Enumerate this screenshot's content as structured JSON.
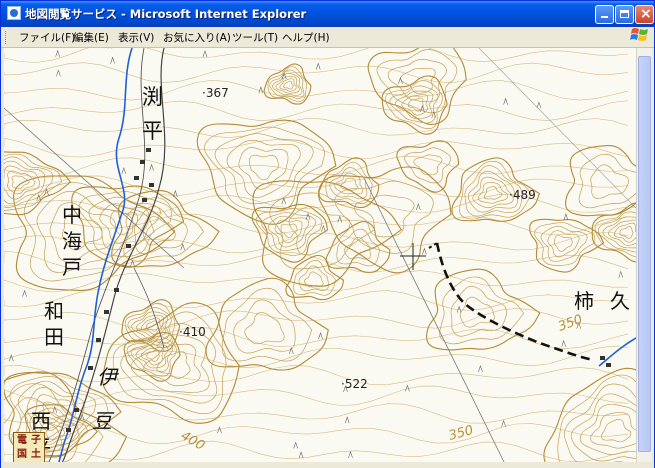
{
  "window": {
    "title": "地図閲覧サービス - Microsoft Internet Explorer",
    "buttons": [
      "minimize",
      "maximize",
      "close"
    ]
  },
  "menu": {
    "items": [
      {
        "label": "ファイル(F)"
      },
      {
        "label": "編集(E)"
      },
      {
        "label": "表示(V)"
      },
      {
        "label": "お気に入り(A)"
      },
      {
        "label": "ツール(T)"
      },
      {
        "label": "ヘルプ(H)"
      }
    ]
  },
  "map": {
    "place_names": {
      "fuchidaira_1": "渕",
      "fuchidaira_2": "平",
      "nakagaito_1": "中",
      "nakagaito_2": "海",
      "nakagaito_3": "戸",
      "wada_1": "和",
      "wada_2": "田",
      "izu_1": "伊",
      "izu_2": "豆",
      "nishi_1": "西",
      "nishi_2": "平",
      "kakikubo_1": "柿",
      "kakikubo_2": "久"
    },
    "elevations": {
      "e367": "367",
      "e489": "489",
      "e410": "410",
      "e522": "522"
    },
    "contour_labels": {
      "c350": "350",
      "c400": "400",
      "c350b": "350"
    },
    "badge": {
      "c1": "電",
      "c2": "子",
      "c3": "国",
      "c4": "土"
    },
    "colors": {
      "contour": "#c4a055",
      "contour_index": "#b28a35",
      "river": "#1f5fd6",
      "road": "#555555",
      "trail": "#111111"
    }
  }
}
